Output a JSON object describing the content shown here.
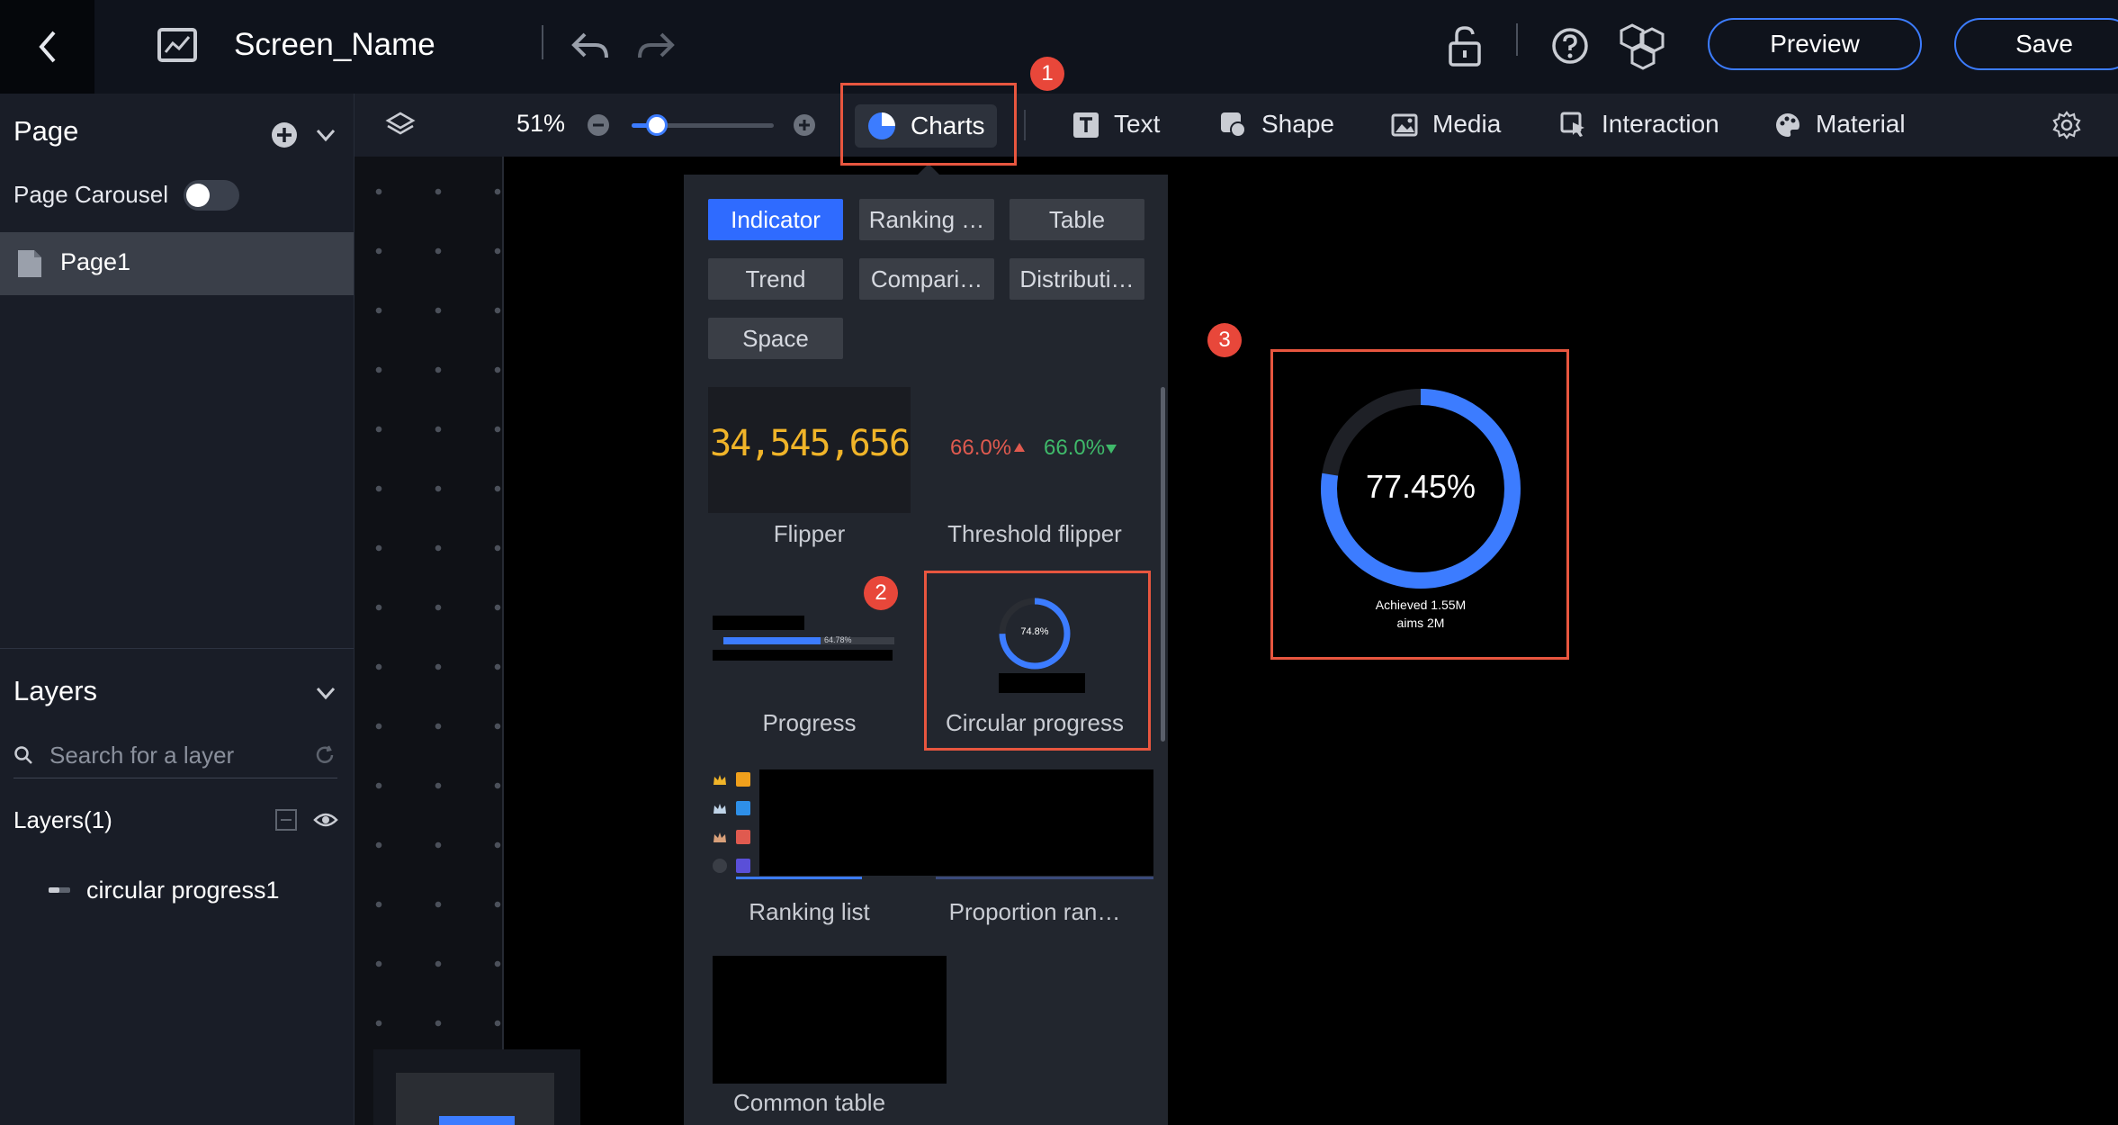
{
  "header": {
    "screen_name": "Screen_Name",
    "preview_label": "Preview",
    "save_label": "Save"
  },
  "left_panel": {
    "page_title": "Page",
    "page_carousel_label": "Page Carousel",
    "page_carousel_enabled": false,
    "pages": [
      "Page1"
    ],
    "layers_title": "Layers",
    "search_placeholder": "Search for a layer",
    "layers_count_label": "Layers(1)",
    "layers": [
      "circular progress1"
    ]
  },
  "toolbar": {
    "zoom": "51%",
    "zoom_fraction": 0.51,
    "charts_label": "Charts",
    "tools": [
      "Text",
      "Shape",
      "Media",
      "Interaction",
      "Material"
    ]
  },
  "charts_panel": {
    "categories": [
      "Indicator",
      "Ranking …",
      "Table",
      "Trend",
      "Compari…",
      "Distributi…",
      "Space"
    ],
    "active_category": "Indicator",
    "flipper_value": "34,545,656",
    "threshold_up": "66.0%",
    "threshold_down": "66.0%",
    "progress_thumb_value": "64.78%",
    "circular_thumb_value": "74.8%",
    "tiles": [
      "Flipper",
      "Threshold flipper",
      "Progress",
      "Circular progress",
      "Ranking list",
      "Proportion ran…",
      "Common table"
    ]
  },
  "markers": [
    "1",
    "2",
    "3"
  ],
  "widget": {
    "value_label": "77.45%",
    "progress_fraction": 0.7745,
    "caption_line1": "Achieved 1.55M",
    "caption_line2": "aims 2M"
  },
  "colors": {
    "accent": "#3c7cff",
    "highlight": "#e8563f",
    "flipper": "#f0b429",
    "up": "#e05a4f",
    "down": "#3fb96a"
  }
}
